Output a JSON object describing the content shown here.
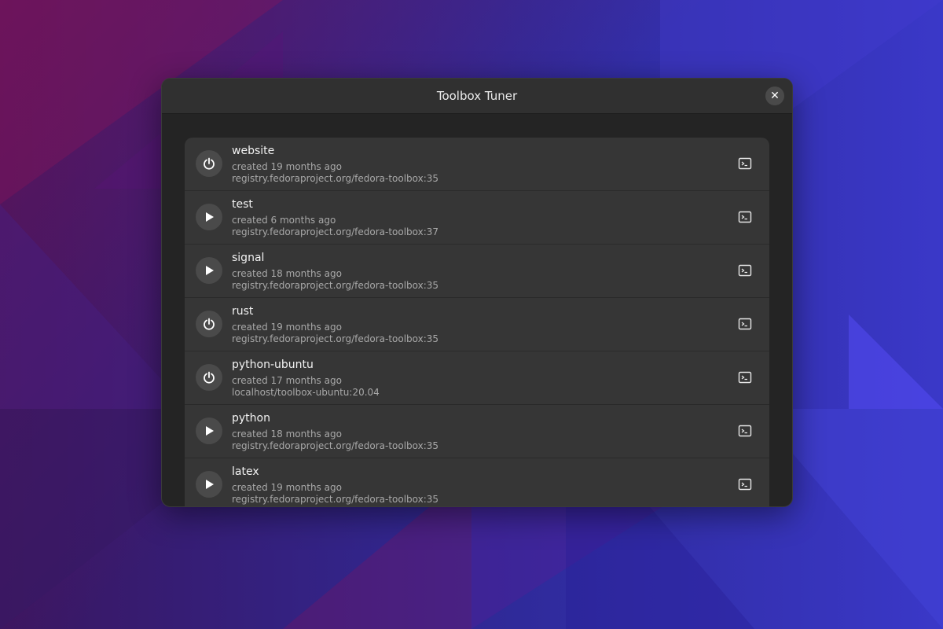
{
  "window": {
    "title": "Toolbox Tuner"
  },
  "colors": {
    "window_bg": "#242424",
    "headerbar_bg": "#303030",
    "row_bg": "#363636",
    "button_bg": "#4a4a4a",
    "text_primary": "#f2f2f2",
    "text_secondary": "#a8a8a8"
  },
  "containers": [
    {
      "name": "website",
      "created": "created 19 months ago",
      "image": "registry.fedoraproject.org/fedora-toolbox:35",
      "state_icon": "power-icon"
    },
    {
      "name": "test",
      "created": "created 6 months ago",
      "image": "registry.fedoraproject.org/fedora-toolbox:37",
      "state_icon": "play-icon"
    },
    {
      "name": "signal",
      "created": "created 18 months ago",
      "image": "registry.fedoraproject.org/fedora-toolbox:35",
      "state_icon": "play-icon"
    },
    {
      "name": "rust",
      "created": "created 19 months ago",
      "image": "registry.fedoraproject.org/fedora-toolbox:35",
      "state_icon": "power-icon"
    },
    {
      "name": "python-ubuntu",
      "created": "created 17 months ago",
      "image": "localhost/toolbox-ubuntu:20.04",
      "state_icon": "power-icon"
    },
    {
      "name": "python",
      "created": "created 18 months ago",
      "image": "registry.fedoraproject.org/fedora-toolbox:35",
      "state_icon": "play-icon"
    },
    {
      "name": "latex",
      "created": "created 19 months ago",
      "image": "registry.fedoraproject.org/fedora-toolbox:35",
      "state_icon": "play-icon"
    }
  ]
}
